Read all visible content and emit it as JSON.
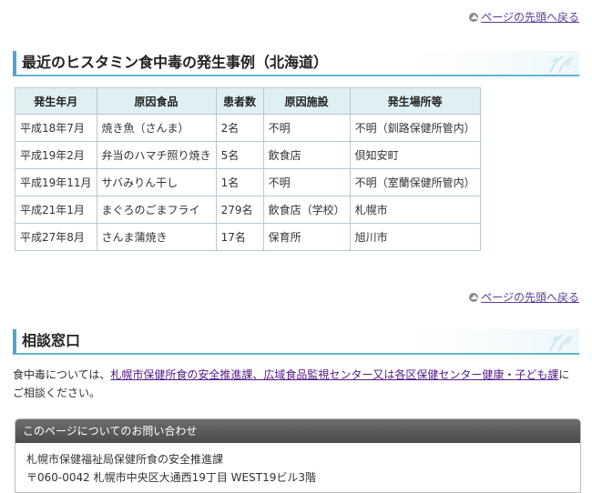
{
  "top_link": {
    "label": "ページの先頭へ戻る"
  },
  "section1": {
    "title": "最近のヒスタミン食中毒の発生事例（北海道）",
    "table": {
      "headers": [
        "発生年月",
        "原因食品",
        "患者数",
        "原因施設",
        "発生場所等"
      ],
      "rows": [
        [
          "平成18年7月",
          "焼き魚（さんま）",
          "2名",
          "不明",
          "不明（釧路保健所管内）"
        ],
        [
          "平成19年2月",
          "弁当のハマチ照り焼き",
          "5名",
          "飲食店",
          "倶知安町"
        ],
        [
          "平成19年11月",
          "サバみりん干し",
          "1名",
          "不明",
          "不明（室蘭保健所管内）"
        ],
        [
          "平成21年1月",
          "まぐろのごまフライ",
          "279名",
          "飲食店（学校）",
          "札幌市"
        ],
        [
          "平成27年8月",
          "さんま蒲焼き",
          "17名",
          "保育所",
          "旭川市"
        ]
      ]
    }
  },
  "section2": {
    "title": "相談窓口",
    "text_before": "食中毒については、",
    "link_text": "札幌市保健所食の安全推進課、広域食品監視センター又は各区保健センター健康・子ども課",
    "text_after": "にご相談ください。"
  },
  "contact": {
    "header": "このページについてのお問い合わせ",
    "org": "札幌市保健福祉局保健所食の安全推進課",
    "address": "〒060-0042 札幌市中央区大通西19丁目 WEST19ビル3階"
  },
  "colors": {
    "accent": "#4fa9c8",
    "table_header_bg": "#dff0f4",
    "link": "#551a8b"
  }
}
